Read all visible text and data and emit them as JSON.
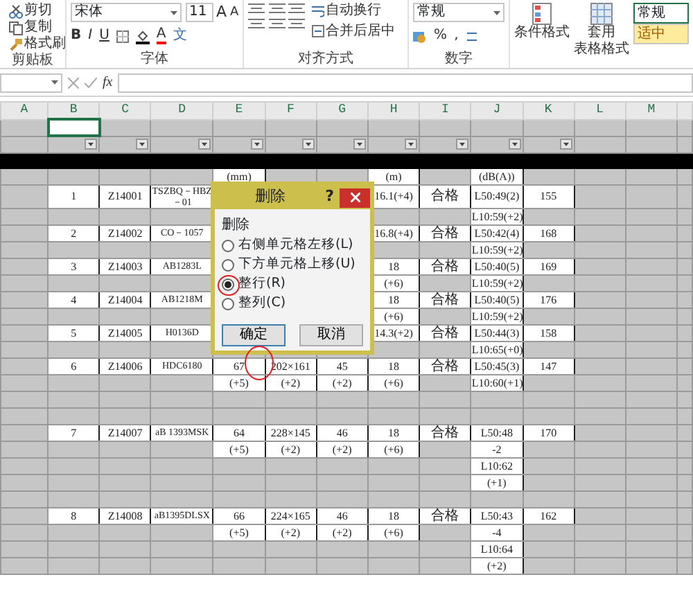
{
  "ribbon": {
    "clipboard": {
      "items": [
        "剪切",
        "复制",
        "格式刷"
      ],
      "label": "剪贴板"
    },
    "font": {
      "name": "宋体",
      "size": "11",
      "grow": "A",
      "shrink": "A",
      "format_buttons": [
        "B",
        "I",
        "U"
      ],
      "font_color": "A",
      "phonetic": "文",
      "label": "字体"
    },
    "alignment": {
      "wrap": "自动换行",
      "merge": "合并后居中",
      "label": "对齐方式"
    },
    "number": {
      "format": "常规",
      "percent": "%",
      "comma": ",",
      "label": "数字"
    },
    "styles": {
      "conditional": "条件格式",
      "table_format": [
        "套用",
        "表格格式"
      ],
      "cell_styles": [
        {
          "label": "常规",
          "color": "#ffffff"
        },
        {
          "label": "适中",
          "color": "#ffeb9c"
        }
      ]
    }
  },
  "formula_bar": {
    "fx": "fx"
  },
  "sheet": {
    "columns": [
      {
        "label": "A",
        "filter": false
      },
      {
        "label": "B",
        "filter": true
      },
      {
        "label": "C",
        "filter": true
      },
      {
        "label": "D",
        "filter": true
      },
      {
        "label": "E",
        "filter": true
      },
      {
        "label": "F",
        "filter": true
      },
      {
        "label": "G",
        "filter": true
      },
      {
        "label": "H",
        "filter": true
      },
      {
        "label": "I",
        "filter": true
      },
      {
        "label": "J",
        "filter": true
      },
      {
        "label": "K",
        "filter": true
      },
      {
        "label": "L",
        "filter": false
      },
      {
        "label": "M",
        "filter": false
      }
    ],
    "first_row": [
      {
        "selected": false
      },
      {
        "selected": true
      },
      {
        "selected": false
      },
      {
        "selected": false
      },
      {
        "selected": false
      },
      {
        "selected": false
      },
      {
        "selected": false
      },
      {
        "selected": false
      },
      {
        "selected": false
      },
      {
        "selected": false
      },
      {
        "selected": false
      }
    ],
    "rows": [
      [
        null,
        null,
        null,
        null,
        "(mm)",
        null,
        null,
        "(m)",
        null,
        "(dB(A))",
        null
      ],
      [
        null,
        "1",
        "Z14001",
        "TSZBQ－HBZ－01",
        null,
        null,
        null,
        "16.1(+4)",
        "合格",
        "L50:49(2)",
        "155"
      ],
      [
        null,
        null,
        null,
        null,
        null,
        null,
        null,
        null,
        null,
        "L10:59(+2)",
        null
      ],
      [
        null,
        "2",
        "Z14002",
        "CO－1057",
        null,
        null,
        null,
        "16.8(+4)",
        "合格",
        "L50:42(4)",
        "168"
      ],
      [
        null,
        null,
        null,
        null,
        null,
        null,
        null,
        null,
        null,
        "L10:59(+2)",
        null
      ],
      [
        null,
        "3",
        "Z14003",
        "AB1283L",
        null,
        null,
        null,
        "18",
        "合格",
        "L50:40(5)",
        "169"
      ],
      [
        null,
        null,
        null,
        null,
        null,
        null,
        null,
        "(+6)",
        null,
        "L10:59(+2)",
        null
      ],
      [
        null,
        "4",
        "Z14004",
        "AB1218M",
        null,
        null,
        null,
        "18",
        "合格",
        "L50:40(5)",
        "176"
      ],
      [
        null,
        null,
        null,
        null,
        null,
        null,
        null,
        "(+6)",
        null,
        "L10:59(+2)",
        null
      ],
      [
        null,
        "5",
        "Z14005",
        "H0136D",
        null,
        null,
        null,
        "14.3(+2)",
        "合格",
        "L50:44(3)",
        "158"
      ],
      [
        null,
        null,
        null,
        null,
        null,
        null,
        null,
        null,
        null,
        "L10:65(+0)",
        null
      ],
      [
        null,
        "6",
        "Z14006",
        "HDC6180",
        "67",
        "202×161",
        "45",
        "18",
        "合格",
        "L50:45(3)",
        "147"
      ],
      [
        null,
        null,
        null,
        null,
        "(+5)",
        "(+2)",
        "(+2)",
        "(+6)",
        null,
        "L10:60(+1)",
        null
      ],
      [
        null,
        null,
        null,
        null,
        null,
        null,
        null,
        null,
        null,
        null,
        null
      ],
      [
        null,
        null,
        null,
        null,
        null,
        null,
        null,
        null,
        null,
        null,
        null
      ],
      [
        null,
        "7",
        "Z14007",
        "aB 1393MSK",
        "64",
        "228×145",
        "46",
        "18",
        "合格",
        "L50:48",
        "170"
      ],
      [
        null,
        null,
        null,
        null,
        "(+5)",
        "(+2)",
        "(+2)",
        "(+6)",
        null,
        "-2",
        null
      ],
      [
        null,
        null,
        null,
        null,
        null,
        null,
        null,
        null,
        null,
        "L10:62",
        null
      ],
      [
        null,
        null,
        null,
        null,
        null,
        null,
        null,
        null,
        null,
        "(+1)",
        null
      ],
      [
        null,
        null,
        null,
        null,
        null,
        null,
        null,
        null,
        null,
        null,
        null
      ],
      [
        null,
        "8",
        "Z14008",
        "aB1395DLSX",
        "66",
        "224×165",
        "46",
        "18",
        "合格",
        "L50:43",
        "162"
      ],
      [
        null,
        null,
        null,
        null,
        "(+5)",
        "(+2)",
        "(+2)",
        "(+6)",
        null,
        "-4",
        null
      ],
      [
        null,
        null,
        null,
        null,
        null,
        null,
        null,
        null,
        null,
        "L10:64",
        null
      ],
      [
        null,
        null,
        null,
        null,
        null,
        null,
        null,
        null,
        null,
        "(+2)",
        null
      ]
    ]
  },
  "dialog": {
    "title": "删除",
    "help": "?",
    "group_label": "删除",
    "options": [
      {
        "label": "右侧单元格左移(L)",
        "selected": false
      },
      {
        "label": "下方单元格上移(U)",
        "selected": false
      },
      {
        "label": "整行(R)",
        "selected": true
      },
      {
        "label": "整列(C)",
        "selected": false
      }
    ],
    "ok": "确定",
    "cancel": "取消"
  }
}
